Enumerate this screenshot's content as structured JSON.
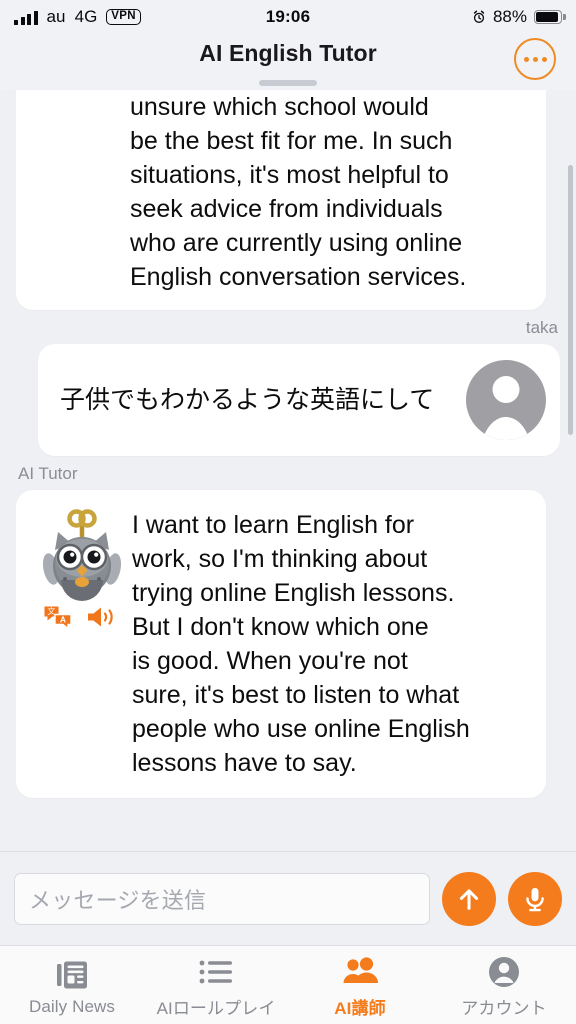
{
  "status_bar": {
    "signal_icon": "signal-bars-icon",
    "carrier": "au",
    "network": "4G",
    "vpn_badge": "VPN",
    "time": "19:06",
    "alarm_icon": "alarm-clock-icon",
    "battery_percent": "88%",
    "battery_icon": "battery-icon"
  },
  "header": {
    "title": "AI English Tutor",
    "menu_icon": "more-options-icon",
    "grabber": "sheet-grabber-handle",
    "accent_color": "#f08a24"
  },
  "chat": {
    "messages": [
      {
        "id": "ai-msg-1",
        "sender": "ai",
        "clipped": true,
        "text": "business English, but I'm\nunsure which school would\nbe the best fit for me. In such\nsituations, it's most helpful to\nseek advice from individuals\nwho are currently using online\nEnglish conversation services."
      },
      {
        "id": "user-msg-1",
        "sender": "user",
        "sender_label": "taka",
        "text": "子供でもわかるような英語にして",
        "avatar_icon": "user-avatar-icon"
      },
      {
        "id": "ai-msg-2",
        "sender": "ai",
        "sender_label": "AI Tutor",
        "avatar_icon": "owl-mascot-icon",
        "translate_icon": "translate-icon",
        "speaker_icon": "speaker-volume-icon",
        "text": "I want to learn English for\nwork, so I'm thinking about\ntrying online English lessons.\nBut I don't know which one\nis good. When you're not\nsure, it's best to listen to what\npeople who use online English\nlessons have to say."
      }
    ],
    "scrollbar": "vertical-scrollbar"
  },
  "composer": {
    "placeholder": "メッセージを送信",
    "value": "",
    "send_icon": "arrow-up-icon",
    "mic_icon": "microphone-icon",
    "button_color": "#f47c1c"
  },
  "tabbar": {
    "active_color": "#f47c1c",
    "inactive_color": "#8a8c93",
    "items": [
      {
        "label": "Daily News",
        "icon": "newspaper-icon",
        "active": false
      },
      {
        "label": "AIロールプレイ",
        "icon": "list-icon",
        "active": false
      },
      {
        "label": "AI講師",
        "icon": "people-icon",
        "active": true
      },
      {
        "label": "アカウント",
        "icon": "account-circle-icon",
        "active": false
      }
    ]
  }
}
